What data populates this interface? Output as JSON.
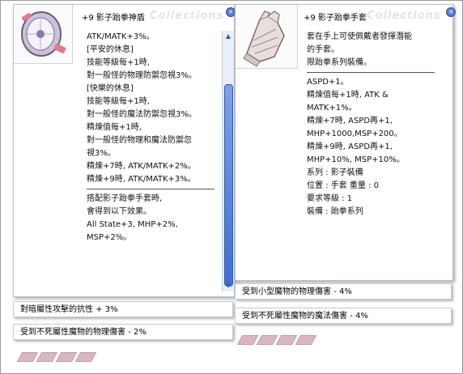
{
  "watermark": "Collections",
  "shield_window": {
    "title": "+9 影子跆拳神盾",
    "icon": "shadow-shield-icon",
    "lines_a": [
      "ATK/MATK+3%。",
      "[平安的休息]",
      "技能等級每+1時,",
      "對一般怪的物理防禦忽視3%。",
      "[快樂的休息]",
      "技能等級每+1時,",
      "對一般怪的魔法防禦忽視3%。",
      "精煉值每+1時,",
      "對一般怪的物理和魔法防禦忽",
      "視3%。",
      "精煉+7時, ATK/MATK+2%。",
      "精煉+9時, ATK/MATK+3%。"
    ],
    "lines_b": [
      "搭配影子跆拳手套時,",
      "會得到以下效果。",
      "All State+3, MHP+2%,",
      "MSP+2%。"
    ]
  },
  "glove_window": {
    "title": "+9 影子跆拳手套",
    "icon": "shadow-glove-icon",
    "lines_a": [
      "套在手上可使佩戴者發揮潛能",
      "的手套。",
      "限跆拳系列裝備。"
    ],
    "lines_b": [
      "ASPD+1。",
      "精煉值每+1時, ATK &",
      "MATK+1%。",
      "精煉+7時, ASPD再+1,",
      "MHP+1000,MSP+200。",
      "精煉+9時, ASPD再+1,",
      "MHP+10%, MSP+10%。",
      "系列 : 影子裝備",
      "位置 : 手套 重量 : 0",
      "要求等級 : 1",
      "裝備 : 跆拳系列"
    ]
  },
  "bars": {
    "left_1": "對暗屬性攻擊的抗性 + 3%",
    "left_2": "受到不死屬性魔物的物理傷害 - 2%",
    "right_1": "受到小型魔物的物理傷害 - 4%",
    "right_2": "受到不死屬性魔物的魔法傷害 - 4%"
  },
  "colors": {
    "accent": "#3e6fd0",
    "card_slot": "#d8b8c0"
  }
}
